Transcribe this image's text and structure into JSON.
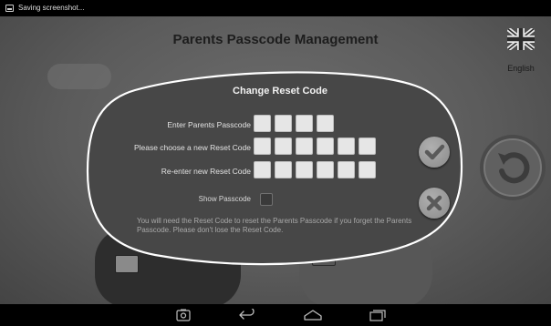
{
  "status_bar": {
    "notification_text": "Saving screenshot...",
    "icon": "screenshot-icon"
  },
  "header": {
    "title": "Parents Passcode Management",
    "language_label": "English",
    "language_icon": "uk-flag-icon"
  },
  "modal": {
    "title": "Change Reset Code",
    "rows": [
      {
        "label": "Enter Parents Passcode",
        "box_count": 4
      },
      {
        "label": "Please choose a new Reset Code",
        "box_count": 6
      },
      {
        "label": "Re-enter new Reset Code",
        "box_count": 6
      }
    ],
    "show_passcode_label": "Show Passcode",
    "show_passcode_checked": false,
    "note": "You will need the Reset Code to reset the Parents Passcode if you forget the Parents Passcode. Please don't lose the Reset Code.",
    "confirm_icon": "check-icon",
    "cancel_icon": "close-icon"
  },
  "background": {
    "back_icon": "return-arrow-icon"
  },
  "nav_bar": {
    "icons": [
      "camera-icon",
      "back-icon",
      "home-icon",
      "recents-icon"
    ]
  },
  "colors": {
    "app_background": "#5f5f5f",
    "modal_fill": "#474747",
    "modal_outline": "#ffffff",
    "input_box": "#e6e6e6",
    "title_text": "#1d1d1d"
  }
}
